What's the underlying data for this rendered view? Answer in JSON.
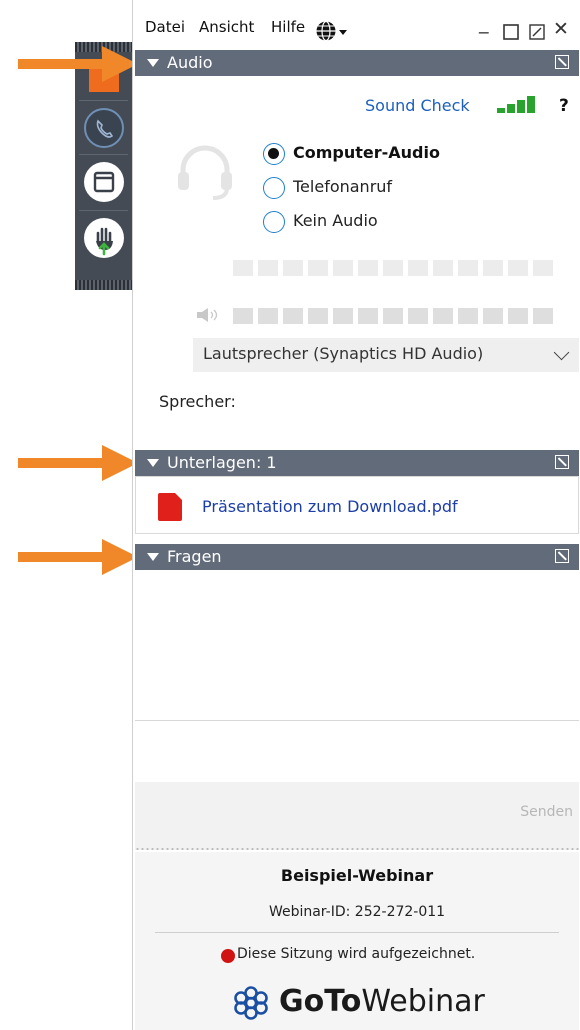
{
  "menu": {
    "datei": "Datei",
    "ansicht": "Ansicht",
    "hilfe": "Hilfe"
  },
  "audio": {
    "header": "Audio",
    "sound_check": "Sound Check",
    "help": "?",
    "options": [
      "Computer-Audio",
      "Telefonanruf",
      "Kein Audio"
    ],
    "selected": "Computer-Audio",
    "speaker_device": "Lautsprecher (Synaptics HD Audio)",
    "speaker_label": "Sprecher:"
  },
  "handouts": {
    "header": "Unterlagen: 1",
    "file": "Präsentation zum Download.pdf"
  },
  "questions": {
    "header": "Fragen",
    "send": "Senden"
  },
  "footer": {
    "title": "Beispiel-Webinar",
    "webinar_id": "Webinar-ID: 252-272-011",
    "recording": "Diese Sitzung wird aufgezeichnet.",
    "logo_goto": "GoTo",
    "logo_webinar": "Webinar"
  },
  "colors": {
    "header_bg": "#626b7a",
    "strip_bg": "#444b55",
    "arrow": "#f0882a",
    "link": "#1d5fbf",
    "signal": "#28a32d",
    "recording": "#d11212"
  },
  "icons": [
    "globe-icon",
    "minimize-icon",
    "maximize-icon",
    "popout-icon",
    "close-icon",
    "headset-icon",
    "speaker-icon",
    "pdf-icon",
    "phone-icon",
    "window-icon",
    "hand-icon",
    "goto-logo-icon"
  ]
}
